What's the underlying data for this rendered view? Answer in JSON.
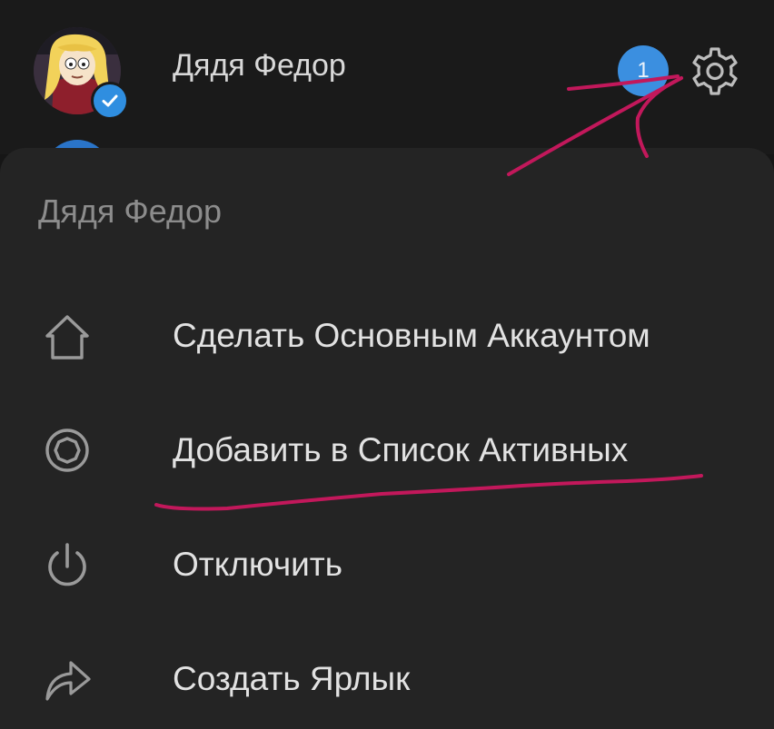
{
  "header": {
    "account_name": "Дядя Федор",
    "notification_count": "1"
  },
  "sheet": {
    "title": "Дядя Федор",
    "items": [
      {
        "label": "Сделать Основным Аккаунтом",
        "icon": "home-icon"
      },
      {
        "label": "Добавить в Список Активных",
        "icon": "record-icon"
      },
      {
        "label": "Отключить",
        "icon": "power-icon"
      },
      {
        "label": "Создать Ярлык",
        "icon": "share-arrow-icon"
      }
    ]
  },
  "colors": {
    "background": "#161616",
    "sheet": "#242424",
    "accent_blue": "#3b8fe0",
    "annotation": "#c2185b"
  }
}
